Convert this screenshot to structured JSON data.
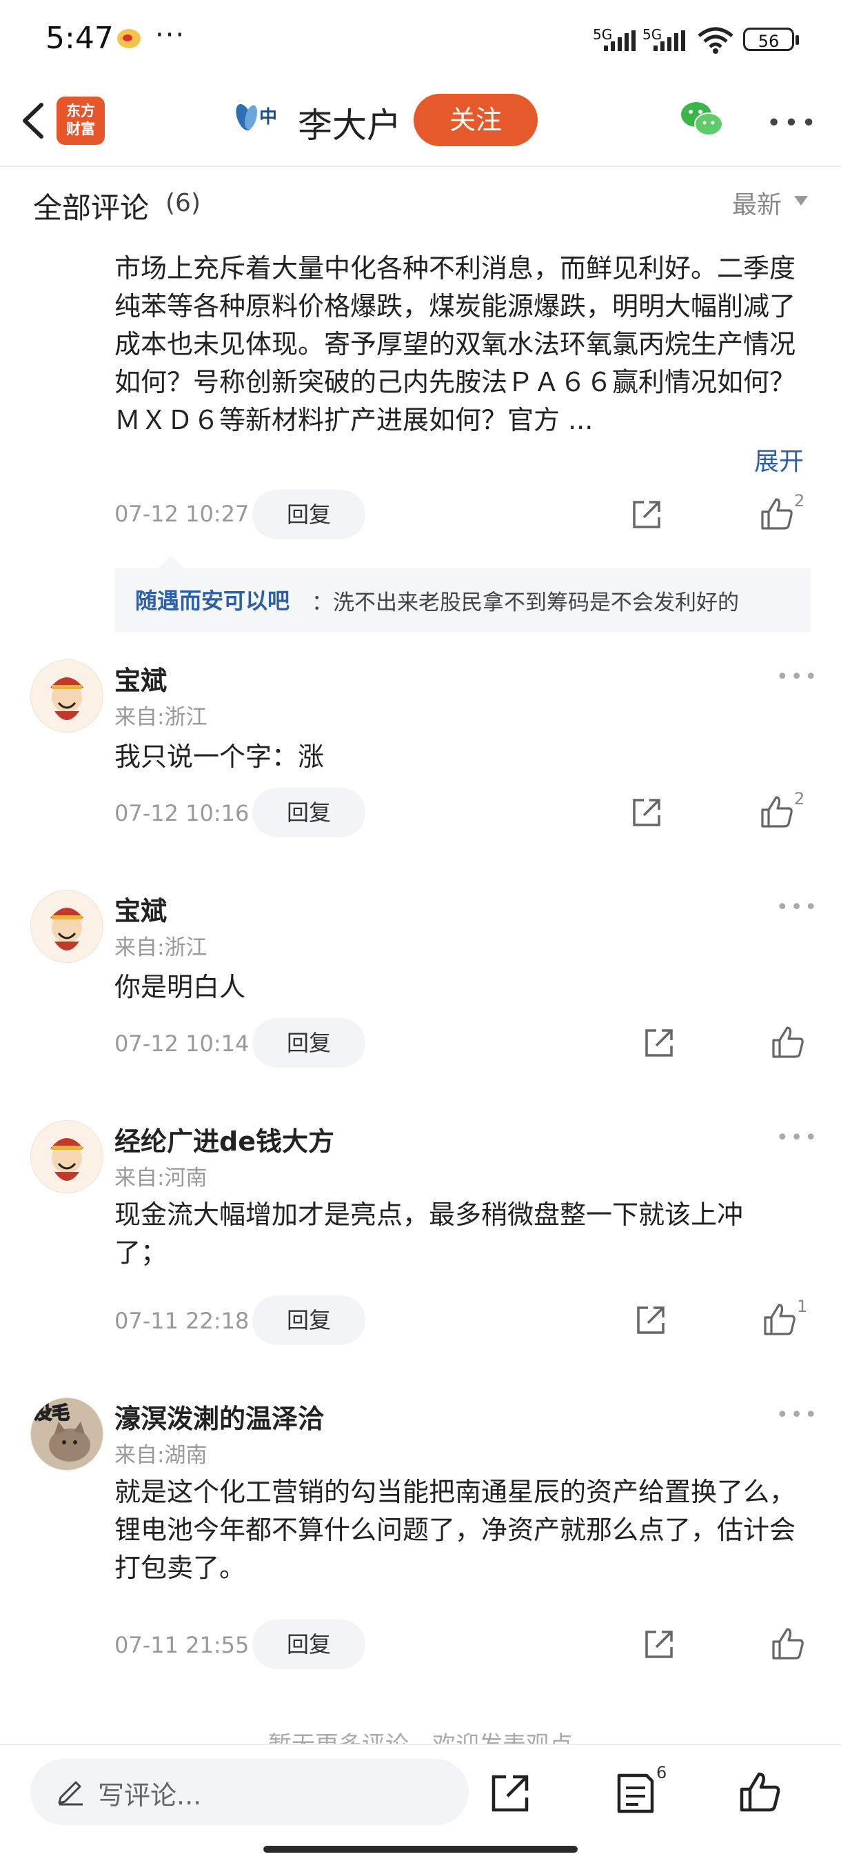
{
  "status_bar": {
    "time": "5:47",
    "more": "···",
    "signal1": "5G",
    "signal2": "5G",
    "wifi_sub": "6",
    "battery": "56"
  },
  "header": {
    "app_logo": "东方\n财富",
    "author_name": "李大户",
    "follow_label": "关注",
    "avatar_text": "中"
  },
  "comments_header": {
    "title": "全部评论",
    "count": "(6)",
    "sort": "最新"
  },
  "comments": [
    {
      "text": "市场上充斥着大量中化各种不利消息，而鲜见利好。二季度纯苯等各种原料价格爆跌，煤炭能源爆跌，明明大幅削减了成本也未见体现。寄予厚望的双氧水法环氧氯丙烷生产情况如何？号称创新突破的己内先胺法ＰＡ６６赢利情况如何？ＭＸＤ６等新材料扩产进展如何？官方 ...",
      "expand": "展开",
      "time": "07-12 10:27",
      "reply": "回复",
      "likes": "2",
      "sub_reply": {
        "name": "随遇而安可以吧",
        "text": "：洗不出来老股民拿不到筹码是不会发利好的"
      }
    },
    {
      "name": "宝斌",
      "from": "来自:浙江",
      "text": "我只说一个字：涨",
      "time": "07-12 10:16",
      "reply": "回复",
      "likes": "2"
    },
    {
      "name": "宝斌",
      "from": "来自:浙江",
      "text": "你是明白人",
      "time": "07-12 10:14",
      "reply": "回复",
      "likes": ""
    },
    {
      "name": "经纶广进de钱大方",
      "from": "来自:河南",
      "text": "现金流大幅增加才是亮点，最多稍微盘整一下就该上冲了；",
      "time": "07-11 22:18",
      "reply": "回复",
      "likes": "1"
    },
    {
      "name": "濠溟泼溂的温泽洽",
      "from": "来自:湖南",
      "text": "就是这个化工营销的勾当能把南通星辰的资产给置换了么，锂电池今年都不算什么问题了，净资产就那么点了，估计会打包卖了。",
      "time": "07-11 21:55",
      "reply": "回复",
      "likes": "",
      "avatar_text": "没毛"
    }
  ],
  "footer": {
    "hint": "暂无更多评论，欢迎发表观点",
    "compose_placeholder": "写评论...",
    "comment_count": "6"
  },
  "colors": {
    "accent": "#e5592a",
    "link": "#2c5fa8"
  }
}
